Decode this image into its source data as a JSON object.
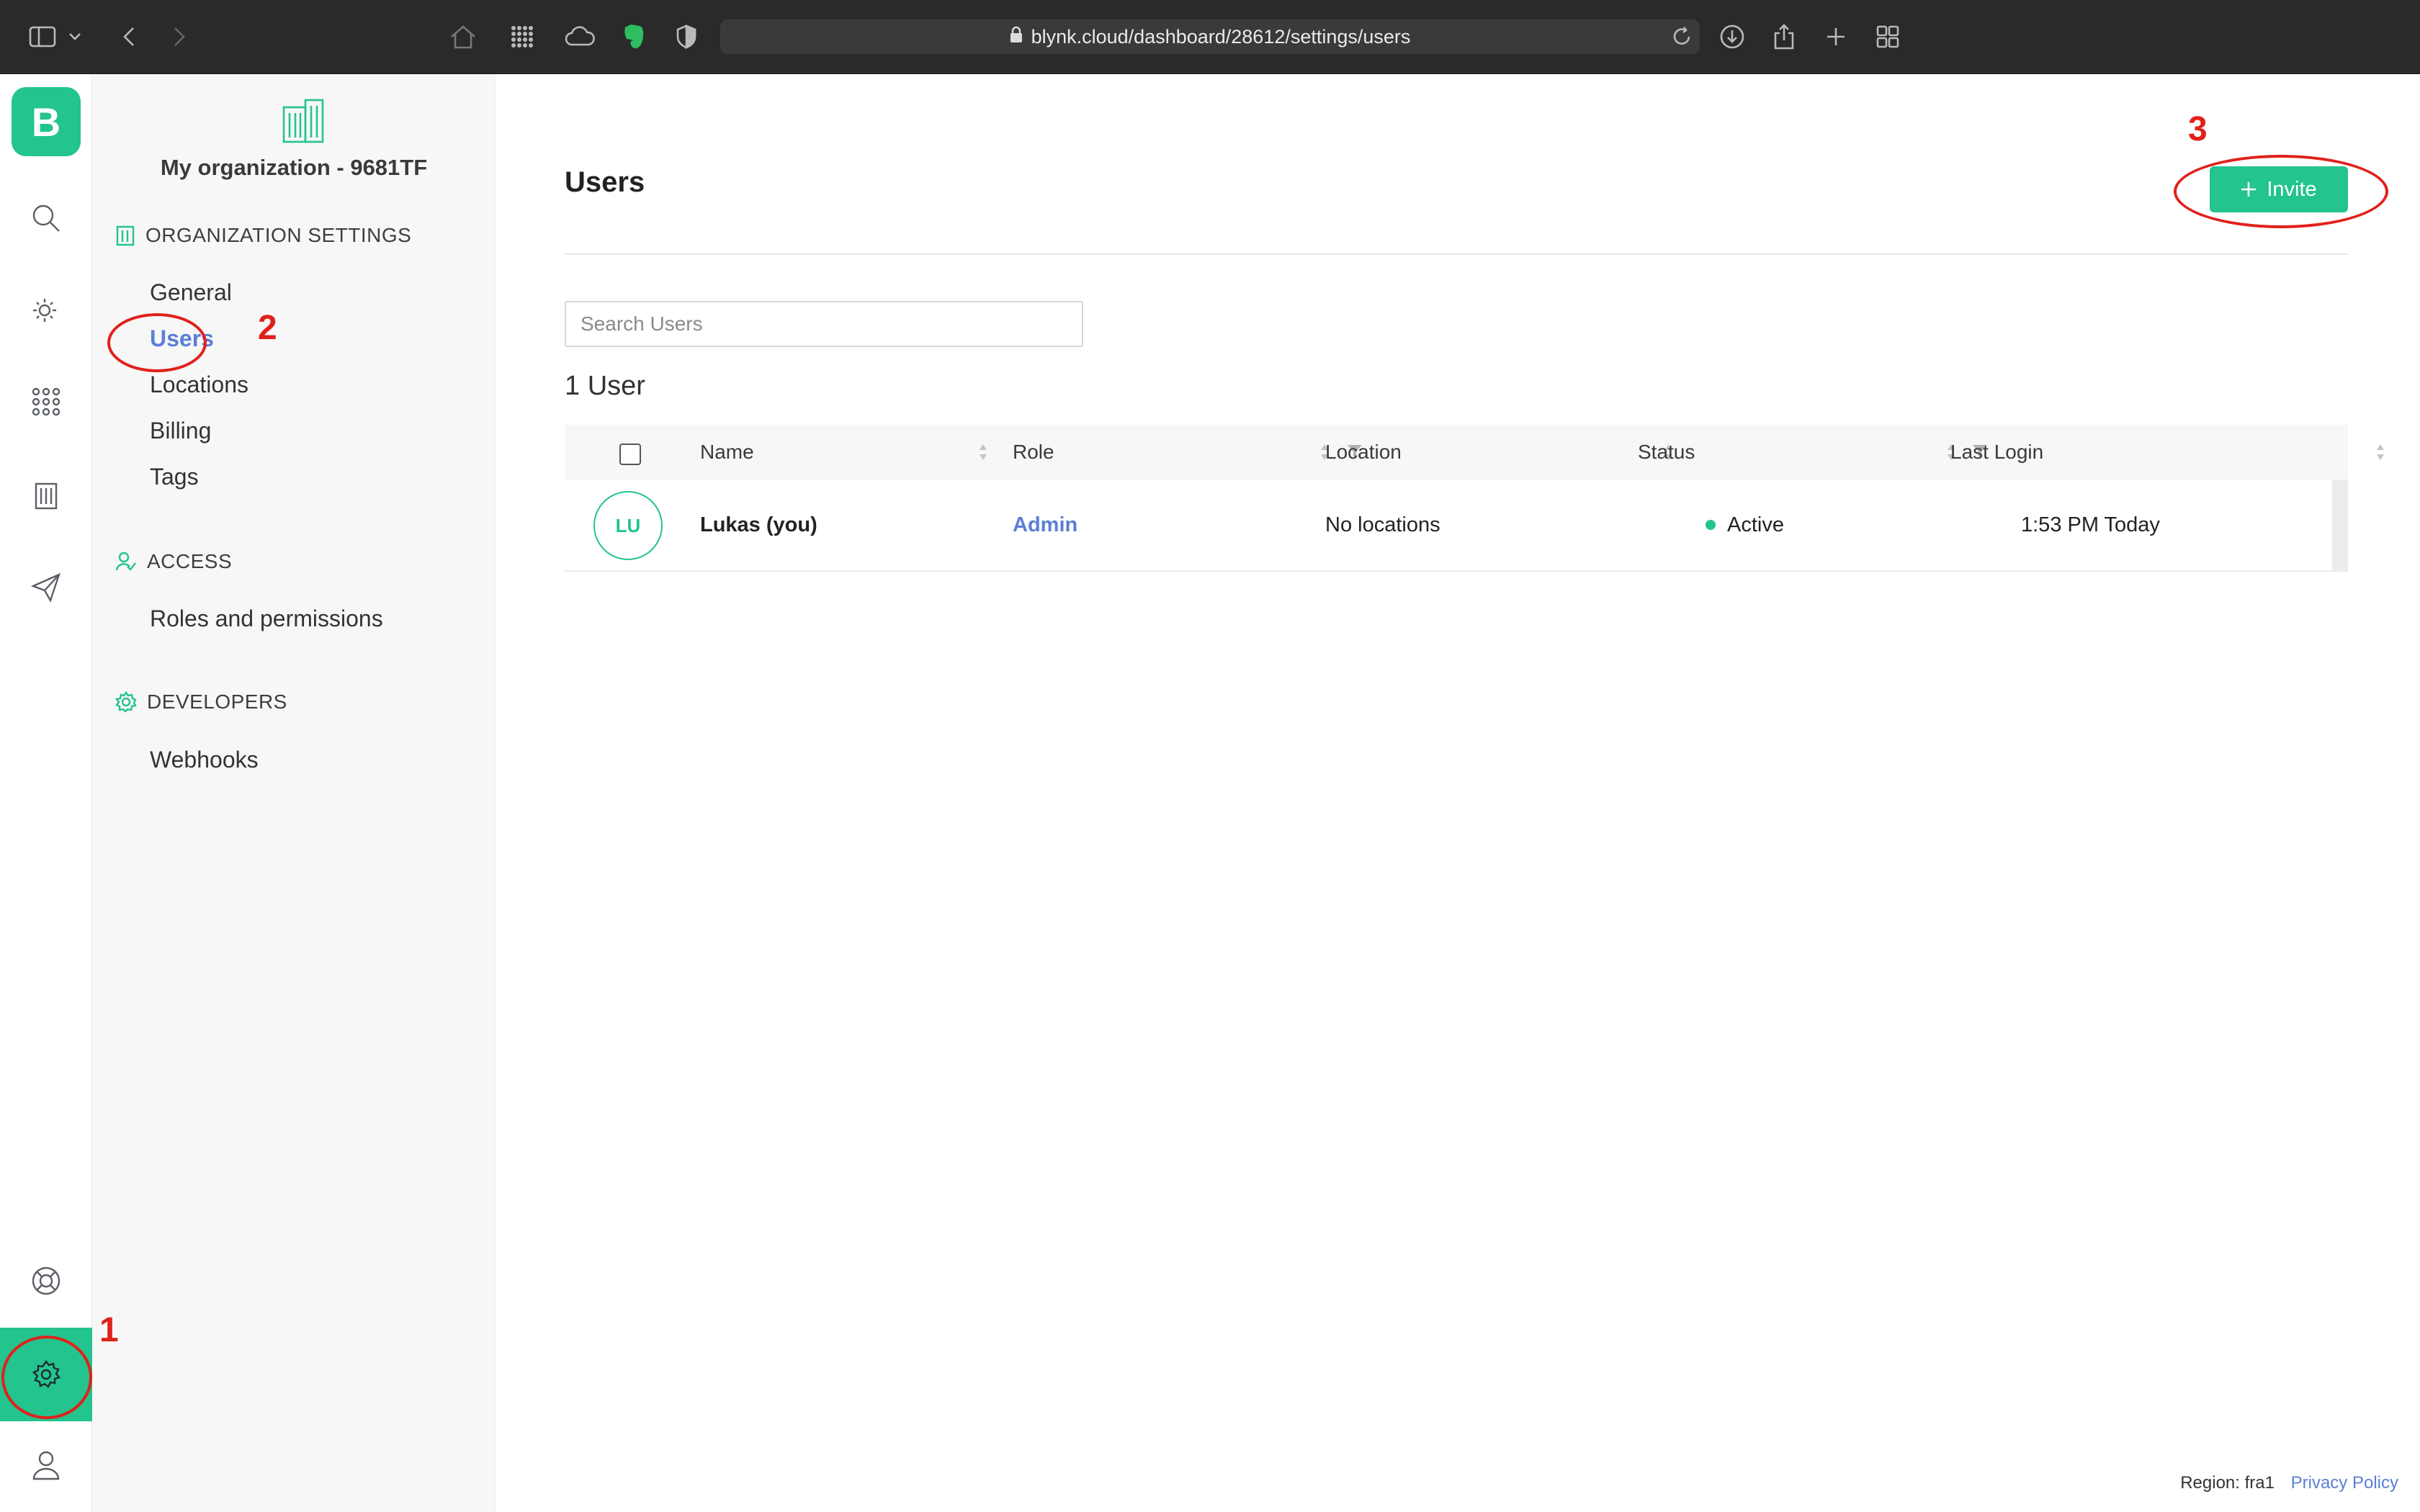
{
  "browser": {
    "url": "blynk.cloud/dashboard/28612/settings/users"
  },
  "rail": {
    "logo_letter": "B"
  },
  "sidebar": {
    "org_name": "My organization - 9681TF",
    "sections": [
      {
        "heading": "ORGANIZATION SETTINGS",
        "items": [
          "General",
          "Users",
          "Locations",
          "Billing",
          "Tags"
        ]
      },
      {
        "heading": "ACCESS",
        "items": [
          "Roles and permissions"
        ]
      },
      {
        "heading": "DEVELOPERS",
        "items": [
          "Webhooks"
        ]
      }
    ],
    "active_item": "Users"
  },
  "main": {
    "title": "Users",
    "invite_label": "Invite",
    "search_placeholder": "Search Users",
    "count_label": "1 User",
    "columns": [
      "Name",
      "Role",
      "Location",
      "Status",
      "Last Login"
    ],
    "rows": [
      {
        "initials": "LU",
        "name": "Lukas (you)",
        "role": "Admin",
        "location": "No locations",
        "status": "Active",
        "last_login": "1:53 PM Today"
      }
    ]
  },
  "footer": {
    "region": "Region: fra1",
    "privacy": "Privacy Policy"
  },
  "annotations": [
    "1",
    "2",
    "3"
  ],
  "colors": {
    "accent": "#23c48e",
    "link": "#5b7fd6",
    "annotation": "#e0211b"
  }
}
